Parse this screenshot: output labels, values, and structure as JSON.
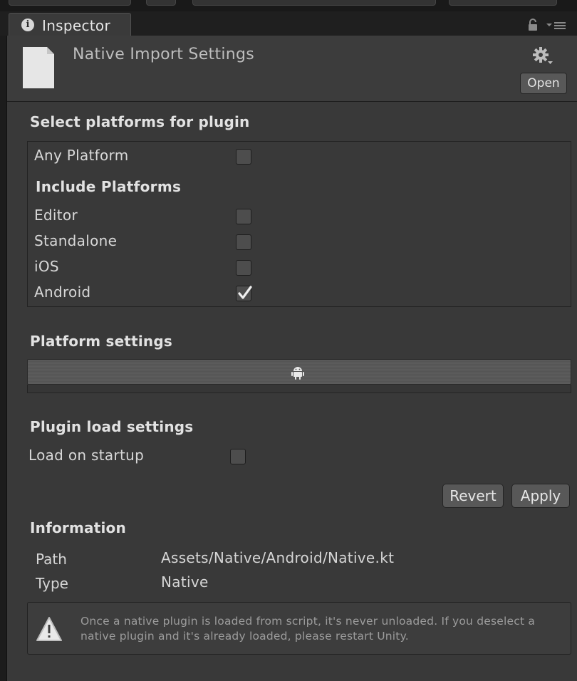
{
  "tab": {
    "label": "Inspector",
    "icon": "info-icon"
  },
  "header": {
    "title": "Native Import Settings",
    "open_label": "Open"
  },
  "platforms": {
    "title": "Select platforms for plugin",
    "any_platform": {
      "label": "Any Platform",
      "checked": false
    },
    "include_title": "Include Platforms",
    "items": [
      {
        "label": "Editor",
        "checked": false
      },
      {
        "label": "Standalone",
        "checked": false
      },
      {
        "label": "iOS",
        "checked": false
      },
      {
        "label": "Android",
        "checked": true
      }
    ]
  },
  "platform_settings": {
    "title": "Platform settings",
    "selected_tab_icon": "android-icon"
  },
  "load_settings": {
    "title": "Plugin load settings",
    "load_on_startup": {
      "label": "Load on startup",
      "checked": false
    }
  },
  "actions": {
    "revert_label": "Revert",
    "apply_label": "Apply"
  },
  "information": {
    "title": "Information",
    "path_key": "Path",
    "path_value": "Assets/Native/Android/Native.kt",
    "type_key": "Type",
    "type_value": "Native"
  },
  "warning": {
    "text": "Once a native plugin is loaded from script, it's never unloaded. If you deselect a native plugin and it's already loaded, please restart Unity."
  },
  "colors": {
    "background": "#393939",
    "header": "#3c3c3c",
    "button": "#585858",
    "text": "#d8d8d8"
  }
}
